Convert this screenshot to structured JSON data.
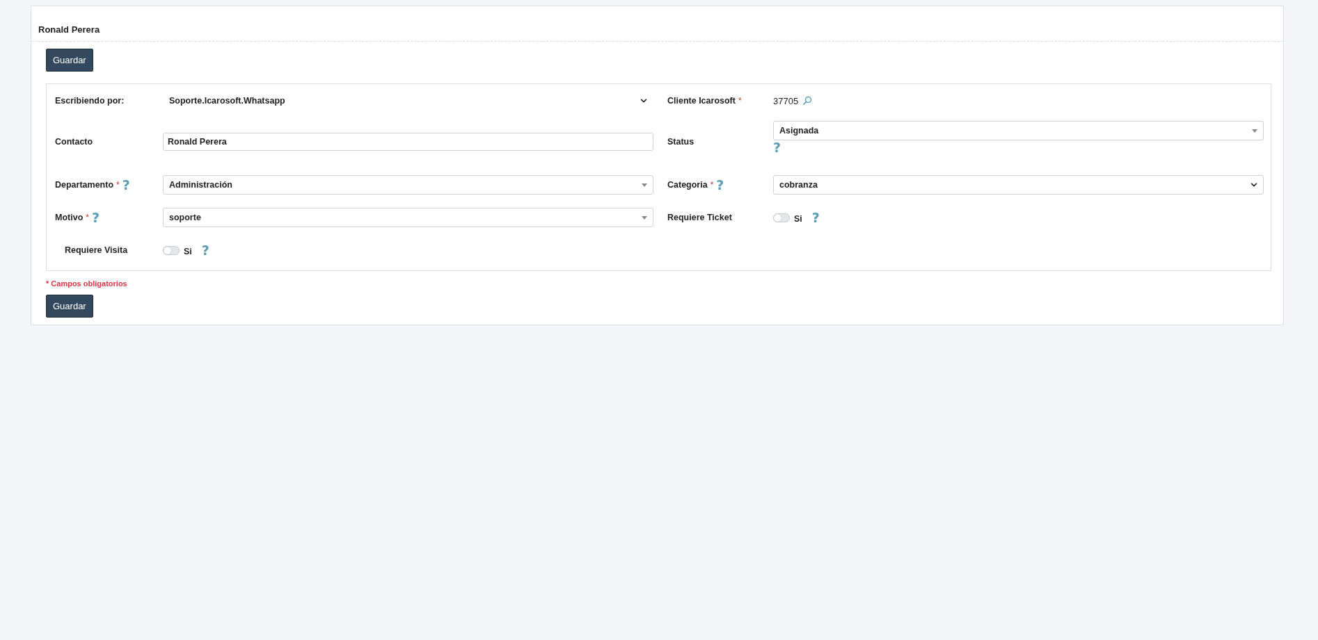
{
  "card": {
    "title": "Ronald Perera",
    "top_button": "Guardar",
    "bottom_button": "Guardar",
    "required_note": "* Campos obligatorios"
  },
  "rows": [
    {
      "left": {
        "label": "Escribiendo por:",
        "kind": "plain-select",
        "value": "Soporte.Icarosoft.Whatsapp"
      },
      "right": {
        "label": "Cliente Icarosoft",
        "required_mark": "*",
        "kind": "search-text",
        "value": "37705"
      }
    },
    {
      "left": {
        "label": "Contacto",
        "kind": "input",
        "value": "Ronald Perera"
      },
      "right": {
        "label": "Status",
        "kind": "combo",
        "value": "Asignada",
        "field_help": "?"
      }
    },
    {
      "left": {
        "label": "Departamento",
        "required_mark": "*",
        "kind": "combo",
        "value": "Administración",
        "label_help": "?"
      },
      "right": {
        "label": "Categoria",
        "required_mark": "*",
        "kind": "native-select",
        "value": "cobranza",
        "label_help": "?"
      }
    },
    {
      "left": {
        "label": "Motivo",
        "required_mark": "*",
        "kind": "combo",
        "value": "soporte",
        "label_help": "?"
      },
      "right": {
        "label": "Requiere Ticket",
        "kind": "toggle",
        "on": false,
        "value": "Si",
        "field_help": "?"
      }
    },
    {
      "left": {
        "label": "Requiere Visita",
        "kind": "toggle",
        "on": false,
        "value": "Si",
        "field_help": "?"
      }
    }
  ]
}
